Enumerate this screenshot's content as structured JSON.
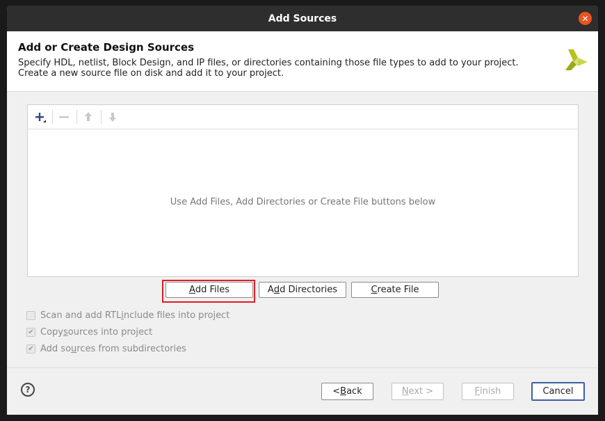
{
  "window": {
    "title": "Add Sources"
  },
  "header": {
    "title": "Add or Create Design Sources",
    "description": "Specify HDL, netlist, Block Design, and IP files, or directories containing those file types to add to your project. Create a new source file on disk and add it to your project."
  },
  "list": {
    "empty_message": "Use Add Files, Add Directories or Create File buttons below",
    "toolbar": [
      {
        "name": "add",
        "icon": "plus-icon"
      },
      {
        "name": "remove",
        "icon": "minus-icon"
      },
      {
        "name": "move-up",
        "icon": "arrow-up-icon"
      },
      {
        "name": "move-down",
        "icon": "arrow-down-icon"
      }
    ]
  },
  "buttons": {
    "add_files": {
      "pre": "",
      "mn": "A",
      "post": "dd Files"
    },
    "add_directories": {
      "pre": "A",
      "mn": "d",
      "post": "d Directories"
    },
    "create_file": {
      "pre": "",
      "mn": "C",
      "post": "reate File"
    }
  },
  "options": {
    "scan_rtl": {
      "pre": "Scan and add RTL ",
      "mn": "i",
      "post": "nclude files into project",
      "checked": false
    },
    "copy_sources": {
      "pre": "Copy ",
      "mn": "s",
      "post": "ources into project",
      "checked": true
    },
    "add_subdirs": {
      "pre": "Add so",
      "mn": "u",
      "post": "rces from subdirectories",
      "checked": true
    }
  },
  "footer": {
    "back": {
      "pre": "< ",
      "mn": "B",
      "post": "ack"
    },
    "next": {
      "pre": "",
      "mn": "N",
      "post": "ext >"
    },
    "finish": {
      "pre": "",
      "mn": "F",
      "post": "inish"
    },
    "cancel": "Cancel"
  },
  "colors": {
    "accent": "#e95420",
    "highlight": "#e01b24",
    "logo": "#b5c21f"
  }
}
